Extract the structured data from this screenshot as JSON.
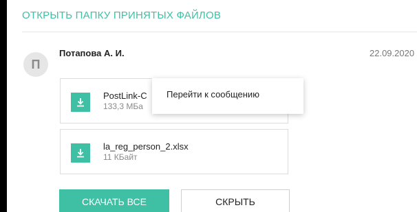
{
  "header": {
    "open_received_files_link": "ОТКРЫТЬ ПАПКУ ПРИНЯТЫХ ФАЙЛОВ"
  },
  "message": {
    "avatar_letter": "П",
    "sender": "Потапова А. И.",
    "date": "22.09.2020",
    "files": [
      {
        "name": "PostLink-C",
        "size": "133,3 МБа",
        "icon": "download-icon"
      },
      {
        "name": "la_reg_person_2.xlsx",
        "size": "11 КБайт",
        "icon": "download-icon"
      }
    ]
  },
  "context_menu": {
    "item_go_to_message": "Перейти к сообщению"
  },
  "actions": {
    "download_all_label": "СКАЧАТЬ ВСЕ",
    "hide_label": "СКРЫТЬ"
  },
  "colors": {
    "accent": "#3fbfa3",
    "background_frame": "#000000"
  }
}
